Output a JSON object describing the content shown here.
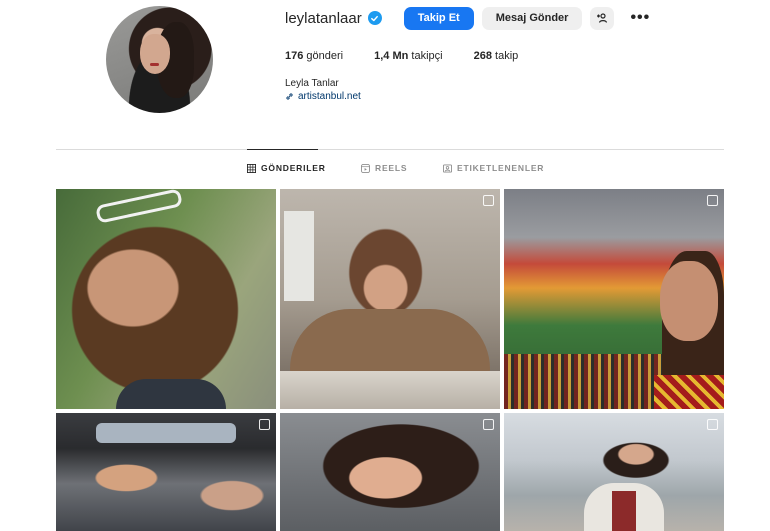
{
  "profile": {
    "username": "leylatanlaar",
    "verified": true,
    "full_name": "Leyla Tanlar",
    "website": "artistanbul.net"
  },
  "actions": {
    "follow_label": "Takip Et",
    "message_label": "Mesaj Gönder",
    "add_icon": "add-user-icon",
    "more_icon": "more-options-icon"
  },
  "stats": [
    {
      "value": "176",
      "label": "gönderi"
    },
    {
      "value": "1,4 Mn",
      "label": "takipçi"
    },
    {
      "value": "268",
      "label": "takip"
    }
  ],
  "tabs": [
    {
      "label": "GÖNDERILER",
      "icon": "grid-icon",
      "active": true
    },
    {
      "label": "REELS",
      "icon": "reels-icon",
      "active": false
    },
    {
      "label": "ETIKETLENENLER",
      "icon": "tagged-icon",
      "active": false
    }
  ],
  "colors": {
    "accent": "#1877f2",
    "verified": "#1d9bf0",
    "link": "#00376b"
  }
}
